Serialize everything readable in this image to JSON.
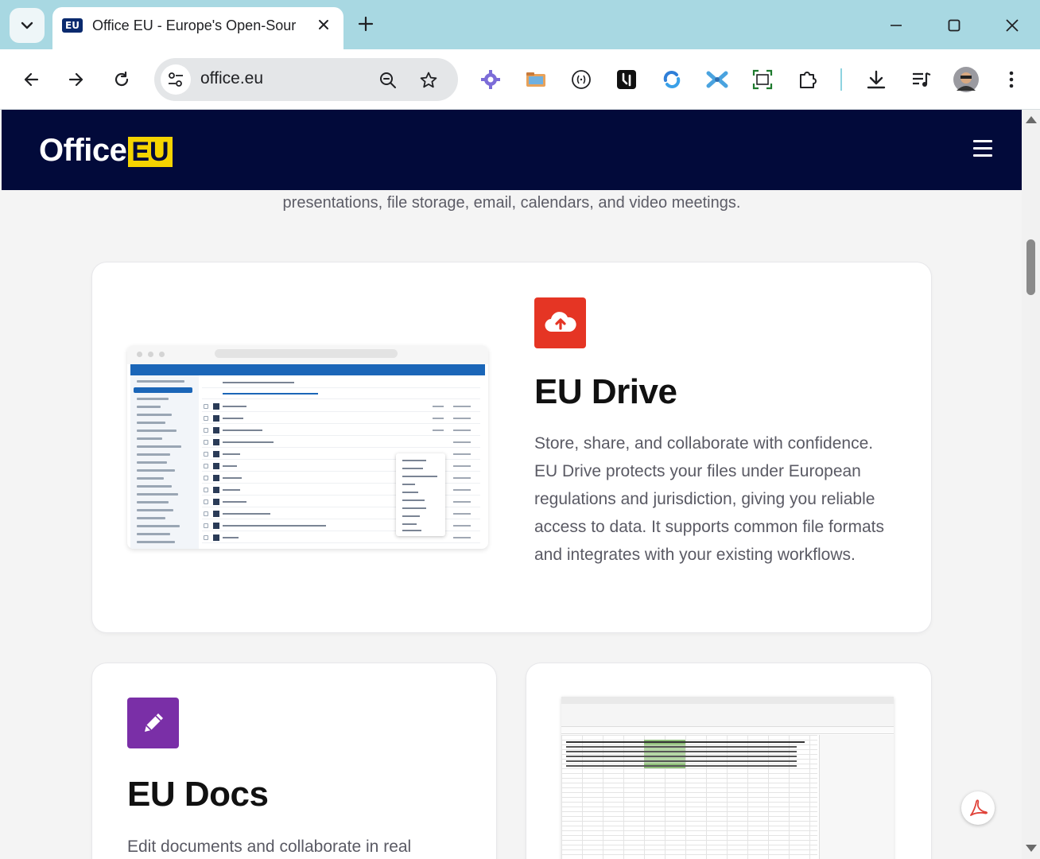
{
  "browser": {
    "tab_title": "Office EU - Europe's Open-Sour",
    "tab_favicon_text": "EU",
    "url": "office.eu",
    "icons": {
      "tab_search": "chevron-down-icon",
      "close_tab": "close-icon",
      "new_tab": "plus-icon",
      "back": "arrow-left-icon",
      "forward": "arrow-right-icon",
      "reload": "reload-icon",
      "site_info": "tune-icon",
      "zoom": "zoom-icon",
      "bookmark": "star-icon",
      "extensions": [
        "gear-extension-icon",
        "folder-extension-icon",
        "code-extension-icon",
        "tool-extension-icon",
        "sync-extension-icon",
        "puzzle-blue-extension-icon",
        "screenshot-extension-icon",
        "extensions-icon"
      ],
      "downloads": "download-icon",
      "media": "media-control-icon",
      "profile": "avatar",
      "menu": "more-vert-icon"
    }
  },
  "site": {
    "logo_text": "Office",
    "logo_badge": "EU",
    "intro_line": "presentations, file storage, email, calendars, and video meetings.",
    "colors": {
      "header_bg": "#020a3a",
      "badge": "#f5d400",
      "drive_red": "#e53524",
      "docs_purple": "#7a2fa7"
    },
    "drive": {
      "title": "EU Drive",
      "description": "Store, share, and collaborate with confidence. EU Drive protects your files under European regulations and jurisdiction, giving you reliable access to data. It supports common file formats and integrates with your existing workflows.",
      "icon": "cloud-upload-icon"
    },
    "docs": {
      "title": "EU Docs",
      "description": "Edit documents and collaborate in real",
      "icon": "pencil-icon"
    }
  }
}
